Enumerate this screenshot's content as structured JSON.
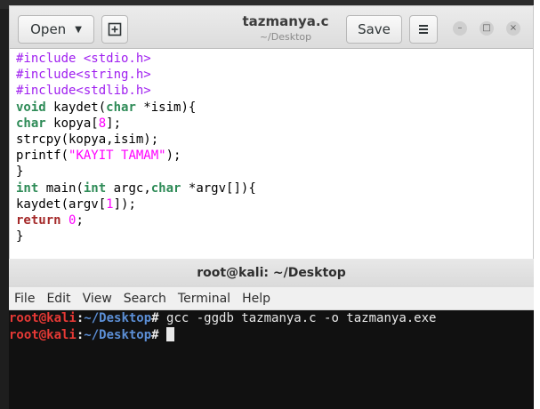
{
  "gedit": {
    "open_label": "Open",
    "title": "tazmanya.c",
    "subtitle": "~/Desktop",
    "save_label": "Save",
    "code_lines": [
      [
        {
          "t": "#include <stdio.h>",
          "c": "pp"
        }
      ],
      [
        {
          "t": "#include<string.h>",
          "c": "pp"
        }
      ],
      [
        {
          "t": "#include<stdlib.h>",
          "c": "pp"
        }
      ],
      [
        {
          "t": "void",
          "c": "kw"
        },
        {
          "t": " kaydet(",
          "c": ""
        },
        {
          "t": "char",
          "c": "kw"
        },
        {
          "t": " *isim){",
          "c": ""
        }
      ],
      [
        {
          "t": "char",
          "c": "kw"
        },
        {
          "t": " kopya[",
          "c": ""
        },
        {
          "t": "8",
          "c": "num"
        },
        {
          "t": "];",
          "c": ""
        }
      ],
      [
        {
          "t": "strcpy(kopya,isim);",
          "c": ""
        }
      ],
      [
        {
          "t": "printf(",
          "c": ""
        },
        {
          "t": "\"KAYIT TAMAM\"",
          "c": "str"
        },
        {
          "t": ");",
          "c": ""
        }
      ],
      [
        {
          "t": "}",
          "c": ""
        }
      ],
      [
        {
          "t": "int",
          "c": "kw"
        },
        {
          "t": " main(",
          "c": ""
        },
        {
          "t": "int",
          "c": "kw"
        },
        {
          "t": " argc,",
          "c": ""
        },
        {
          "t": "char",
          "c": "kw"
        },
        {
          "t": " *argv[]){",
          "c": ""
        }
      ],
      [
        {
          "t": "kaydet(argv[",
          "c": ""
        },
        {
          "t": "1",
          "c": "num"
        },
        {
          "t": "]);",
          "c": ""
        }
      ],
      [
        {
          "t": "return",
          "c": "kwp"
        },
        {
          "t": " ",
          "c": ""
        },
        {
          "t": "0",
          "c": "num"
        },
        {
          "t": ";",
          "c": ""
        }
      ],
      [
        {
          "t": "}",
          "c": ""
        }
      ]
    ]
  },
  "terminal": {
    "title": "root@kali: ~/Desktop",
    "menu": [
      "File",
      "Edit",
      "View",
      "Search",
      "Terminal",
      "Help"
    ],
    "prompt_user": "root@kali",
    "prompt_colon": ":",
    "prompt_path": "~/Desktop",
    "prompt_hash": "#",
    "lines": [
      {
        "command": " gcc -ggdb tazmanya.c -o tazmanya.exe"
      },
      {
        "command": " "
      }
    ]
  }
}
